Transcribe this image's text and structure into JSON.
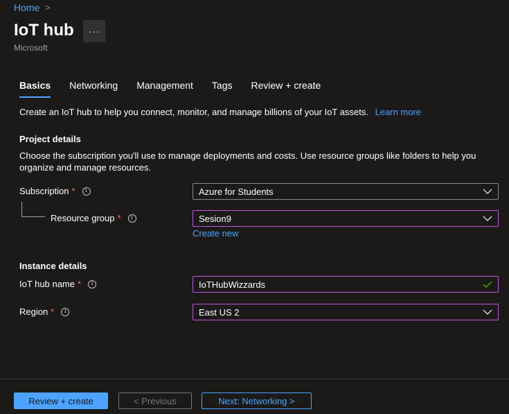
{
  "breadcrumb": {
    "home": "Home",
    "separator": ">"
  },
  "header": {
    "title": "IoT hub",
    "more": "···",
    "subtitle": "Microsoft"
  },
  "tabs": [
    {
      "label": "Basics",
      "active": true
    },
    {
      "label": "Networking"
    },
    {
      "label": "Management"
    },
    {
      "label": "Tags"
    },
    {
      "label": "Review + create"
    }
  ],
  "intro": {
    "text": "Create an IoT hub to help you connect, monitor, and manage billions of your IoT assets.",
    "link": "Learn more"
  },
  "project": {
    "title": "Project details",
    "description": "Choose the subscription you'll use to manage deployments and costs. Use resource groups like folders to help you organize and manage resources.",
    "subscription": {
      "label": "Subscription",
      "required": "*",
      "value": "Azure for Students"
    },
    "resource_group": {
      "label": "Resource group",
      "required": "*",
      "value": "Sesion9",
      "create_new": "Create new"
    }
  },
  "instance": {
    "title": "Instance details",
    "hub_name": {
      "label": "IoT hub name",
      "required": "*",
      "value": "IoTHubWizzards"
    },
    "region": {
      "label": "Region",
      "required": "*",
      "value": "East US 2"
    }
  },
  "footer": {
    "review_create": "Review + create",
    "previous": "< Previous",
    "next": "Next: Networking >"
  },
  "colors": {
    "accent": "#4da3ff",
    "focus_border": "#c455e0",
    "required": "#f1707b",
    "valid": "#57a300"
  }
}
